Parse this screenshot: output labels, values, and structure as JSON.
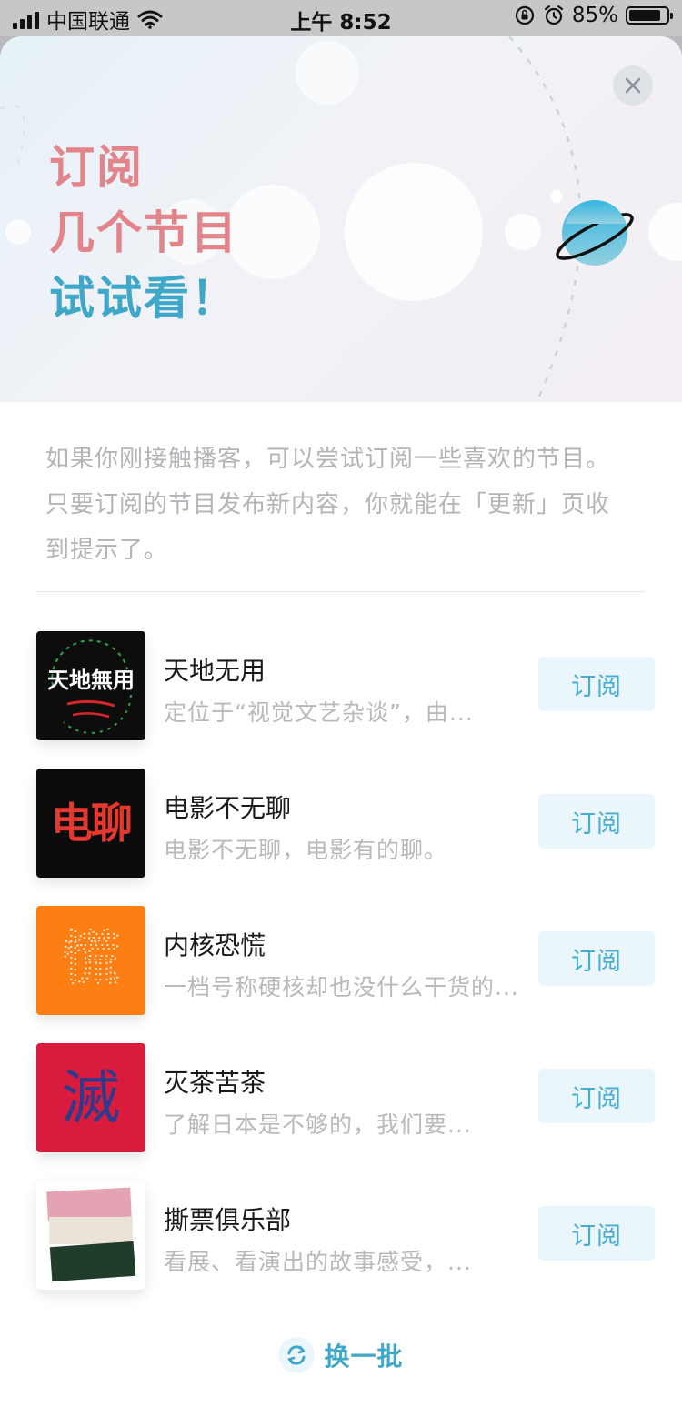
{
  "status_bar": {
    "carrier": "中国联通",
    "time": "上午 8:52",
    "battery": "85%",
    "battery_level": 0.85
  },
  "hero": {
    "line1": "订阅",
    "line2": "几个节目",
    "line3": "试试看！"
  },
  "intro": "如果你刚接触播客，可以尝试订阅一些喜欢的节目。只要订阅的节目发布新内容，你就能在「更新」页收到提示了。",
  "podcasts": [
    {
      "title": "天地无用",
      "desc": "定位于“视觉文艺杂谈”，由...",
      "button": "订阅",
      "cover_text": "天地無用"
    },
    {
      "title": "电影不无聊",
      "desc": "电影不无聊，电影有的聊。",
      "button": "订阅",
      "cover_text": "电聊"
    },
    {
      "title": "内核恐慌",
      "desc": "一档号称硬核却也没什么干货的...",
      "button": "订阅",
      "cover_text": "慌"
    },
    {
      "title": "灭茶苦茶",
      "desc": "了解日本是不够的，我们要...",
      "button": "订阅",
      "cover_text": "滅"
    },
    {
      "title": "撕票俱乐部",
      "desc": "看展、看演出的故事感受，...",
      "button": "订阅",
      "cover_text": ""
    }
  ],
  "refresh": {
    "label": "换一批"
  },
  "colors": {
    "accent": "#47acd1",
    "hero_pink": "#e3848a",
    "hero_blue": "#3fa7c8",
    "cover_orange": "#fd7e12",
    "cover_red": "#d91b3e"
  }
}
